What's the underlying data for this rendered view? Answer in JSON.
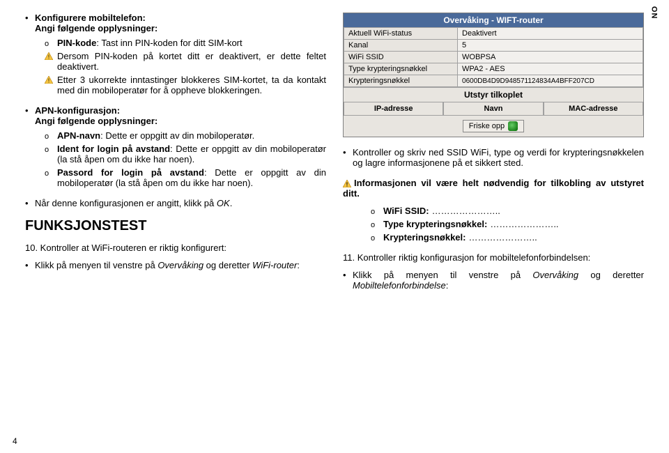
{
  "lang_tab": "NO",
  "page_number": "4",
  "left": {
    "sec1_title": "Konfigurere mobiltelefon:",
    "sec1_sub": "Angi følgende opplysninger:",
    "pin_line_prefix": "PIN-kode",
    "pin_line_rest": ": Tast inn PIN-koden for ditt SIM-kort",
    "warn1": "Dersom PIN-koden på kortet ditt er deaktivert, er dette feltet deaktivert.",
    "warn2": "Etter 3 ukorrekte inntastinger blokkeres SIM-kortet, ta da kontakt med din mobiloperatør for å oppheve blokkeringen.",
    "sec2_title": "APN-konfigurasjon:",
    "sec2_sub": "Angi følgende opplysninger:",
    "apn_name_prefix": "APN-navn",
    "apn_name_rest": ": Dette er oppgitt av din mobiloperatør.",
    "ident_prefix": "Ident for login på avstand",
    "ident_rest": ": Dette er oppgitt av din mobiloperatør (la stå åpen om du ikke har noen).",
    "pass_prefix": "Passord for login på avstand",
    "pass_rest": ": Dette er oppgitt av din mobiloperatør (la stå åpen om du ikke har noen).",
    "done_prefix": "Når denne konfigurasjonen er angitt, klikk på ",
    "done_ok": "OK",
    "h2": "FUNKSJONSTEST",
    "step10": "10. Kontroller at WiFi-routeren er riktig konfigurert:",
    "step10_sub_prefix": "Klikk på menyen til venstre på ",
    "step10_sub_ov": "Overvåking",
    "step10_sub_mid": " og deretter ",
    "step10_sub_wifi": "WiFi-router",
    "colon": ":"
  },
  "router": {
    "title": "Overvåking - WIFT-router",
    "r1k": "Aktuell WiFi-status",
    "r1v": "Deaktivert",
    "r2k": "Kanal",
    "r2v": "5",
    "r3k": "WiFi SSID",
    "r3v": "WOBPSA",
    "r4k": "Type krypteringsnøkkel",
    "r4v": "WPA2 - AES",
    "r5k": "Krypteringsnøkkel",
    "r5v": "0600DB4D9D948571124834A4BFF207CD",
    "sect": "Utstyr tilkoplet",
    "c1": "IP-adresse",
    "c2": "Navn",
    "c3": "MAC-adresse",
    "btn": "Friske opp"
  },
  "right": {
    "bullet1": "Kontroller og skriv ned SSID WiFi, type og verdi for krypteringsnøkkelen og lagre informasjonene på et sikkert sted.",
    "warn": "Informasjonen vil være helt nødvendig for tilkobling av utstyret ditt.",
    "line1": "WiFi SSID:",
    "line2": "Type krypteringsnøkkel:",
    "line3": "Krypteringsnøkkel:",
    "dots": "…………………..",
    "step11": "11. Kontroller riktig konfigurasjon for mobiltelefonforbindelsen:",
    "step11_sub_prefix": "Klikk på menyen til venstre på ",
    "step11_ov": "Overvåking",
    "step11_mid": " og deretter ",
    "step11_mob": "Mobiltelefonforbindelse",
    "colon": ":"
  }
}
